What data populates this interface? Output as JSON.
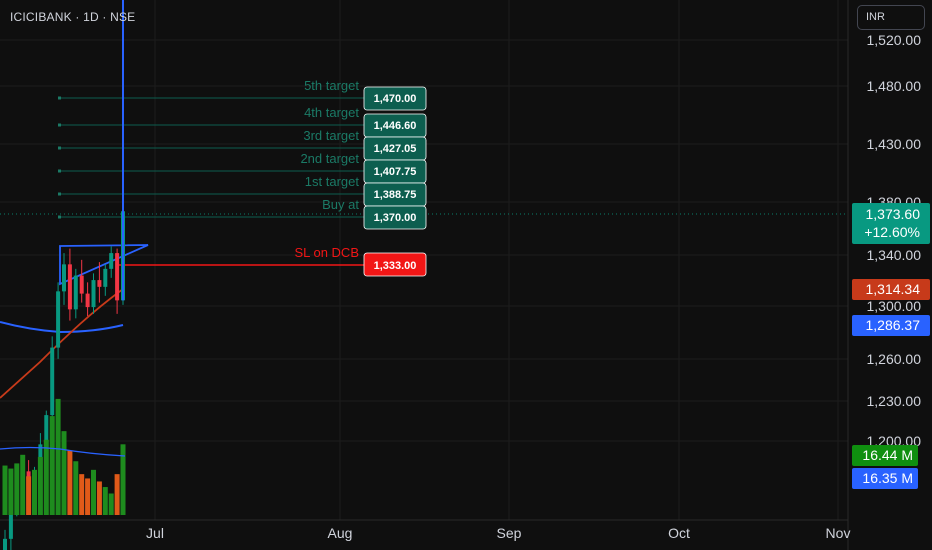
{
  "header": {
    "ticker": "ICICIBANK · 1D · NSE",
    "currency_button": "INR"
  },
  "colors": {
    "background": "#0f0f0f",
    "grid": "#1c1c1c",
    "up": "#089981",
    "down": "#f23645",
    "target_box": "#0d5e4f",
    "target_text": "#1b7a66",
    "stop_loss": "#f21616",
    "ema_fast": "#c73a1a",
    "ema_slow": "#2962ff",
    "blue_badge": "#2962ff",
    "volume_up": "#1e8c1e",
    "volume_down": "#e05a19",
    "volume_ma": "#2962ff",
    "spike": "#2962ff"
  },
  "chart_data": {
    "type": "candlestick",
    "title": "ICICIBANK · 1D · NSE",
    "y_axis": {
      "ticks": [
        "1,520.00",
        "1,480.00",
        "1,430.00",
        "1,380.00",
        "1,340.00",
        "1,300.00",
        "1,260.00",
        "1,230.00",
        "1,200.00"
      ],
      "tick_values": [
        1520,
        1480,
        1430,
        1380,
        1340,
        1300,
        1260,
        1230,
        1200
      ]
    },
    "x_axis": {
      "labels": [
        "Jul",
        "Aug",
        "Sep",
        "Oct",
        "Nov"
      ]
    },
    "levels": [
      {
        "label": "5th target",
        "value": 1470.0,
        "text": "1,470.00",
        "kind": "target"
      },
      {
        "label": "4th target",
        "value": 1446.6,
        "text": "1,446.60",
        "kind": "target"
      },
      {
        "label": "3rd target",
        "value": 1427.05,
        "text": "1,427.05",
        "kind": "target"
      },
      {
        "label": "2nd target",
        "value": 1407.75,
        "text": "1,407.75",
        "kind": "target"
      },
      {
        "label": "1st target",
        "value": 1388.75,
        "text": "1,388.75",
        "kind": "target"
      },
      {
        "label": "Buy at",
        "value": 1370.0,
        "text": "1,370.00",
        "kind": "target"
      },
      {
        "label": "SL on DCB",
        "value": 1333.0,
        "text": "1,333.00",
        "kind": "stop"
      }
    ],
    "badges": {
      "last_price": "1,373.60",
      "change": "+12.60%",
      "ema_fast": "1,314.34",
      "ema_slow": "1,286.37",
      "volume": "16.44 M",
      "volume_ma": "16.35 M"
    },
    "candles": [
      {
        "o": 1218,
        "h": 1232,
        "l": 1205,
        "c": 1228
      },
      {
        "o": 1228,
        "h": 1248,
        "l": 1222,
        "c": 1244
      },
      {
        "o": 1244,
        "h": 1252,
        "l": 1238,
        "c": 1248
      },
      {
        "o": 1248,
        "h": 1262,
        "l": 1242,
        "c": 1258
      },
      {
        "o": 1258,
        "h": 1263,
        "l": 1246,
        "c": 1250
      },
      {
        "o": 1250,
        "h": 1260,
        "l": 1244,
        "c": 1255
      },
      {
        "o": 1255,
        "h": 1275,
        "l": 1250,
        "c": 1270
      },
      {
        "o": 1270,
        "h": 1285,
        "l": 1265,
        "c": 1283
      },
      {
        "o": 1283,
        "h": 1318,
        "l": 1280,
        "c": 1313
      },
      {
        "o": 1313,
        "h": 1342,
        "l": 1308,
        "c": 1338
      },
      {
        "o": 1338,
        "h": 1355,
        "l": 1332,
        "c": 1350
      },
      {
        "o": 1350,
        "h": 1357,
        "l": 1325,
        "c": 1330
      },
      {
        "o": 1330,
        "h": 1348,
        "l": 1326,
        "c": 1345
      },
      {
        "o": 1345,
        "h": 1352,
        "l": 1333,
        "c": 1337
      },
      {
        "o": 1337,
        "h": 1342,
        "l": 1327,
        "c": 1331
      },
      {
        "o": 1331,
        "h": 1346,
        "l": 1328,
        "c": 1343
      },
      {
        "o": 1343,
        "h": 1351,
        "l": 1333,
        "c": 1340
      },
      {
        "o": 1340,
        "h": 1350,
        "l": 1336,
        "c": 1348
      },
      {
        "o": 1348,
        "h": 1358,
        "l": 1344,
        "c": 1355
      },
      {
        "o": 1355,
        "h": 1357,
        "l": 1328,
        "c": 1334
      },
      {
        "o": 1334,
        "h": 1485,
        "l": 1332,
        "c": 1373.6
      }
    ],
    "volume": [
      {
        "v": 11.5,
        "up": true
      },
      {
        "v": 10.8,
        "up": true
      },
      {
        "v": 12.0,
        "up": true
      },
      {
        "v": 14.0,
        "up": true
      },
      {
        "v": 9.0,
        "up": false
      },
      {
        "v": 10.5,
        "up": true
      },
      {
        "v": 13.5,
        "up": true
      },
      {
        "v": 17.5,
        "up": true
      },
      {
        "v": 23.0,
        "up": true
      },
      {
        "v": 27.0,
        "up": true
      },
      {
        "v": 19.5,
        "up": true
      },
      {
        "v": 15.0,
        "up": false
      },
      {
        "v": 12.5,
        "up": true
      },
      {
        "v": 9.5,
        "up": false
      },
      {
        "v": 8.5,
        "up": false
      },
      {
        "v": 10.5,
        "up": true
      },
      {
        "v": 7.8,
        "up": false
      },
      {
        "v": 6.5,
        "up": true
      },
      {
        "v": 5.0,
        "up": true
      },
      {
        "v": 9.5,
        "up": false
      },
      {
        "v": 16.44,
        "up": true
      }
    ]
  }
}
